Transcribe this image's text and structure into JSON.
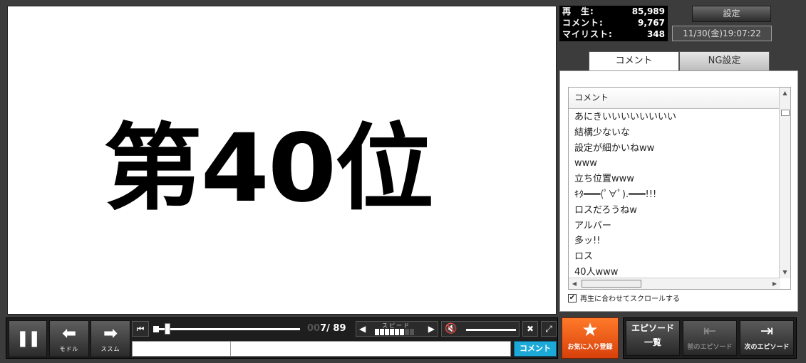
{
  "video": {
    "title": "第40位"
  },
  "stats": [
    {
      "label": "再　生:",
      "value": "85,989"
    },
    {
      "label": "コメント:",
      "value": "9,767"
    },
    {
      "label": "マイリスト:",
      "value": "348"
    }
  ],
  "header": {
    "settings_label": "設定",
    "datetime": "11/30(金)19:07:22"
  },
  "tabs": [
    {
      "label": "コメント",
      "active": true
    },
    {
      "label": "NG設定",
      "active": false
    }
  ],
  "comment_list": {
    "header": "コメント",
    "items": [
      "あにきいいいいいいいい",
      "結構少ないな",
      "設定が細かいねww",
      "www",
      "立ち位置www",
      "ｷﾀ━━━(ﾟ∀ﾟ).━━━!!!",
      "ロスだろうねw",
      "アルバー",
      "多ッ!!",
      "ロス",
      "40人www"
    ],
    "scroll_with_playback_label": "再生に合わせてスクロールする",
    "scroll_with_playback_checked": true
  },
  "controls": {
    "back_label": "モドル",
    "forward_label": "ススム",
    "time_prefix": "00",
    "time_current": "7",
    "time_total": "/ 89",
    "speed_label": "スピード",
    "comment_submit_label": "コメント",
    "comment_input_value": ""
  },
  "right_buttons": {
    "favorite_label": "お気に入り登録",
    "episode_list_label_1": "エピソード",
    "episode_list_label_2": "一覧",
    "prev_episode_label": "前のエピソード",
    "next_episode_label": "次のエピソード"
  },
  "colors": {
    "comment_button": "#1da9d8",
    "favorite_button": "#e85a14",
    "background": "#3c3c3c"
  }
}
